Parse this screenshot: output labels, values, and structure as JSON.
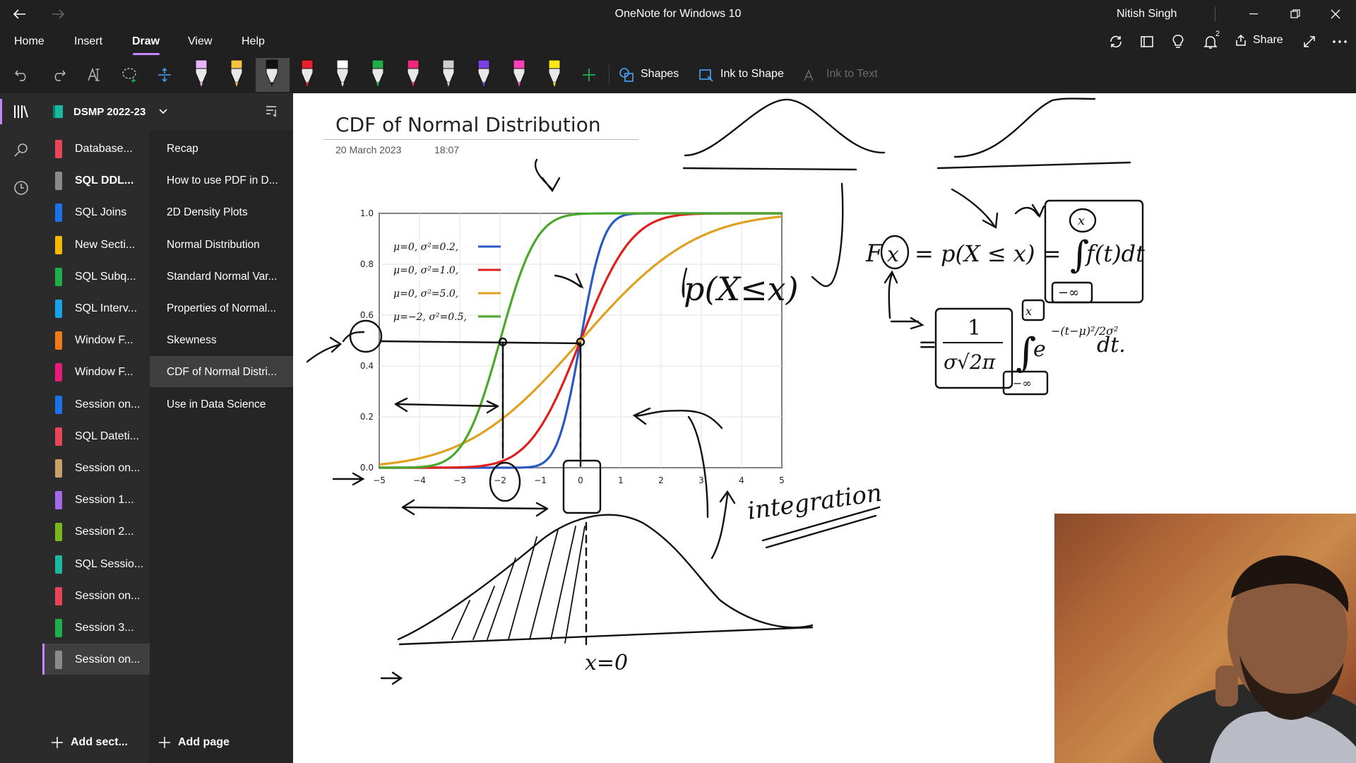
{
  "window": {
    "title": "OneNote for Windows 10",
    "user": "Nitish Singh"
  },
  "ribbon": {
    "tabs": [
      "Home",
      "Insert",
      "Draw",
      "View",
      "Help"
    ],
    "active_tab": "Draw",
    "share_label": "Share",
    "notification_count": "2"
  },
  "toolbar": {
    "shapes_label": "Shapes",
    "ink_to_shape_label": "Ink to Shape",
    "ink_to_text_label": "Ink to Text",
    "pens": [
      {
        "name": "highlighter-pen",
        "color": "#e8b4ff"
      },
      {
        "name": "pencil",
        "color": "#f5c242"
      },
      {
        "name": "pen-black",
        "color": "#111111"
      },
      {
        "name": "pen-red",
        "color": "#e8202a"
      },
      {
        "name": "pen-white",
        "color": "#ffffff"
      },
      {
        "name": "pen-green",
        "color": "#1fae4a"
      },
      {
        "name": "pen-pink",
        "color": "#f0287a"
      },
      {
        "name": "pen-galaxy",
        "color": "#cfcfcf"
      },
      {
        "name": "pen-purple",
        "color": "#7b3fe4"
      },
      {
        "name": "pen-magenta",
        "color": "#ff3fb8"
      },
      {
        "name": "highlighter-yellow",
        "color": "#ffe81a"
      }
    ]
  },
  "notebook": {
    "name": "DSMP 2022-23",
    "sections": [
      {
        "label": "Database...",
        "color": "#e8455a"
      },
      {
        "label": "SQL DDL...",
        "color": "#8a8a8a",
        "bold": true
      },
      {
        "label": "SQL Joins",
        "color": "#1a73e8"
      },
      {
        "label": "New Secti...",
        "color": "#f5b800"
      },
      {
        "label": "SQL Subq...",
        "color": "#1fae4a"
      },
      {
        "label": "SQL Interv...",
        "color": "#1aa3e8"
      },
      {
        "label": "Window F...",
        "color": "#f07a1a"
      },
      {
        "label": "Window F...",
        "color": "#e81a7a"
      },
      {
        "label": "Session on...",
        "color": "#1a73e8"
      },
      {
        "label": "SQL Dateti...",
        "color": "#e8455a"
      },
      {
        "label": "Session on...",
        "color": "#c9a06a"
      },
      {
        "label": "Session 1...",
        "color": "#a06ae8"
      },
      {
        "label": "Session 2...",
        "color": "#7ab81a"
      },
      {
        "label": "SQL Sessio...",
        "color": "#1ab8a0"
      },
      {
        "label": "Session on...",
        "color": "#e8455a"
      },
      {
        "label": "Session 3...",
        "color": "#1fae4a"
      },
      {
        "label": "Session on...",
        "color": "#8a8a8a"
      }
    ],
    "pages": [
      "Recap",
      "How to use PDF in D...",
      "2D Density Plots",
      "Normal Distribution",
      "Standard Normal Var...",
      "Properties of Normal...",
      "Skewness",
      "CDF of Normal Distri...",
      "Use in Data Science"
    ],
    "selected_page": 7,
    "add_section_label": "Add sect...",
    "add_page_label": "Add page"
  },
  "page": {
    "title": "CDF of Normal Distribution",
    "date": "20 March 2023",
    "time": "18:07",
    "handwriting_integration": "integration",
    "handwriting_x0": "x=0",
    "handwriting_prob": "p(X≤x)"
  },
  "chart_data": {
    "type": "line",
    "x": [
      -5,
      -4,
      -3,
      -2,
      -1,
      0,
      1,
      2,
      3,
      4,
      5
    ],
    "xlim": [
      -5,
      5
    ],
    "ylim": [
      0,
      1
    ],
    "xticks": [
      "−5",
      "−4",
      "−3",
      "−2",
      "−1",
      "0",
      "1",
      "2",
      "3",
      "4",
      "5"
    ],
    "yticks": [
      "0.0",
      "0.2",
      "0.4",
      "0.6",
      "0.8",
      "1.0"
    ],
    "grid": true,
    "legend_position": "top-left",
    "series": [
      {
        "name": "μ=0,  σ²=0.2,",
        "color": "#2b59c3",
        "mu": 0,
        "var": 0.2
      },
      {
        "name": "μ=0,  σ²=1.0,",
        "color": "#e0201c",
        "mu": 0,
        "var": 1.0
      },
      {
        "name": "μ=0,  σ²=5.0,",
        "color": "#e0a020",
        "mu": 0,
        "var": 5.0
      },
      {
        "name": "μ=−2, σ²=0.5,",
        "color": "#4aa82a",
        "mu": -2,
        "var": 0.5
      }
    ]
  }
}
